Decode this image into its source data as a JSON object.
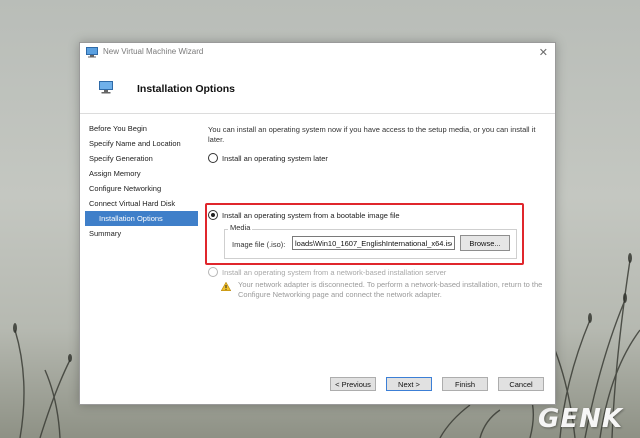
{
  "window": {
    "title": "New Virtual Machine Wizard",
    "close_glyph": "✕"
  },
  "header": {
    "title": "Installation Options"
  },
  "nav": {
    "items": [
      {
        "label": "Before You Begin",
        "active": false
      },
      {
        "label": "Specify Name and Location",
        "active": false
      },
      {
        "label": "Specify Generation",
        "active": false
      },
      {
        "label": "Assign Memory",
        "active": false
      },
      {
        "label": "Configure Networking",
        "active": false
      },
      {
        "label": "Connect Virtual Hard Disk",
        "active": false
      },
      {
        "label": "Installation Options",
        "active": true
      },
      {
        "label": "Summary",
        "active": false
      }
    ]
  },
  "content": {
    "intro": "You can install an operating system now if you have access to the setup media, or you can install it later.",
    "option_later": "Install an operating system later",
    "option_image": "Install an operating system from a bootable image file",
    "media_group": "Media",
    "image_file_label": "Image file (.iso):",
    "image_file_value": "loads\\Win10_1607_EnglishInternational_x64.iso",
    "browse_label": "Browse...",
    "option_network": "Install an operating system from a network-based installation server",
    "warning_text": "Your network adapter is disconnected. To perform a network-based installation, return to the Configure Networking page and connect the network adapter."
  },
  "buttons": {
    "previous": "< Previous",
    "next": "Next >",
    "finish": "Finish",
    "cancel": "Cancel"
  },
  "watermark": "GENK",
  "colors": {
    "accent": "#3f7fc9",
    "highlight_border": "#e0262c"
  }
}
